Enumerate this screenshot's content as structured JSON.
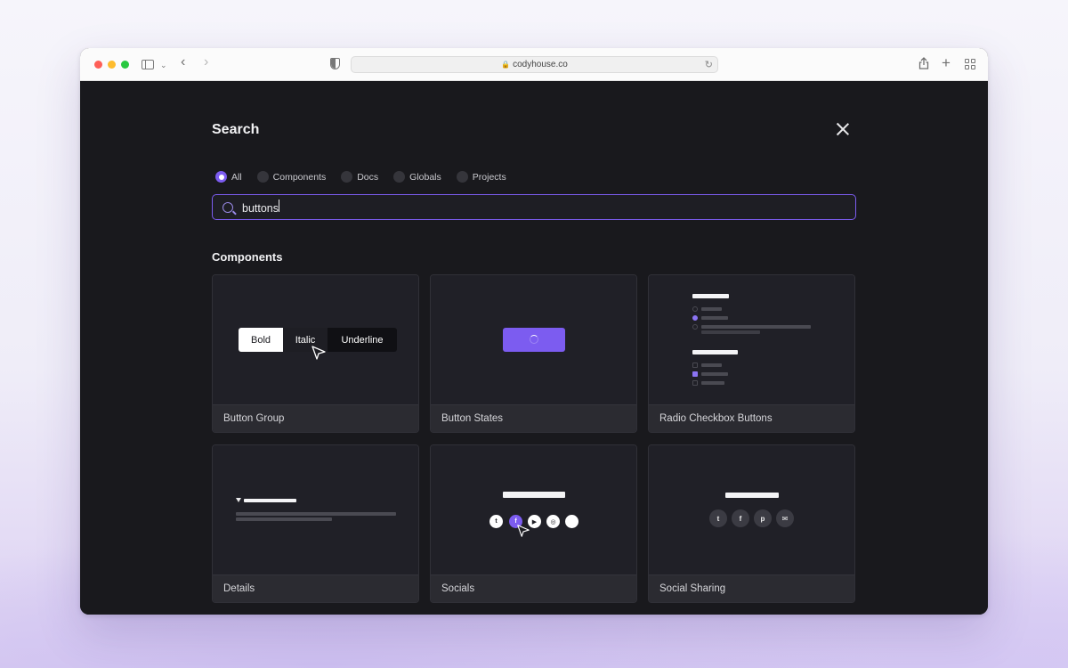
{
  "browser": {
    "url": "codyhouse.co"
  },
  "search": {
    "title": "Search",
    "query": "buttons",
    "filters": [
      {
        "label": "All",
        "checked": true
      },
      {
        "label": "Components",
        "checked": false
      },
      {
        "label": "Docs",
        "checked": false
      },
      {
        "label": "Globals",
        "checked": false
      },
      {
        "label": "Projects",
        "checked": false
      }
    ]
  },
  "results": {
    "section_title": "Components",
    "cards": [
      {
        "label": "Button Group",
        "preview_buttons": [
          "Bold",
          "Italic",
          "Underline"
        ]
      },
      {
        "label": "Button States"
      },
      {
        "label": "Radio Checkbox Buttons"
      },
      {
        "label": "Details"
      },
      {
        "label": "Socials",
        "icons": [
          "twitter-icon",
          "facebook-icon",
          "youtube-icon",
          "dribbble-icon",
          "circle-icon"
        ]
      },
      {
        "label": "Social Sharing",
        "icons": [
          "twitter-icon",
          "facebook-icon",
          "pinterest-icon",
          "mail-icon"
        ]
      }
    ]
  },
  "colors": {
    "accent": "#7c5cf0",
    "background": "#19191d",
    "card_label_bg": "#2b2b31"
  }
}
